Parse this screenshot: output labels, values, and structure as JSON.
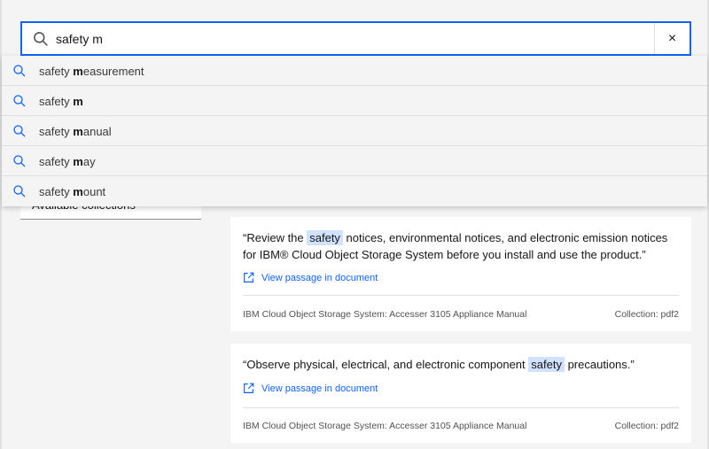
{
  "search": {
    "value": "safety m",
    "clear_label": "×"
  },
  "suggestions": [
    {
      "prefix": "safety ",
      "match": "m",
      "rest": "easurement"
    },
    {
      "prefix": "safety ",
      "match": "m",
      "rest": ""
    },
    {
      "prefix": "safety ",
      "match": "m",
      "rest": "anual"
    },
    {
      "prefix": "safety ",
      "match": "m",
      "rest": "ay"
    },
    {
      "prefix": "safety ",
      "match": "m",
      "rest": "ount"
    }
  ],
  "collections_dropdown": {
    "label": "Available collections",
    "chevron": "⌄"
  },
  "results": [
    {
      "quote_before": "“Review the ",
      "highlight": "safety",
      "quote_after": " notices, environmental notices, and electronic emission notices for IBM® Cloud Object Storage System before you install and use the product.”",
      "view_label": "View passage in document",
      "source": "IBM Cloud Object Storage System: Accesser 3105 Appliance Manual",
      "collection": "Collection: pdf2"
    },
    {
      "quote_before": "“Observe physical, electrical, and electronic component ",
      "highlight": "safety",
      "quote_after": " precautions.”",
      "view_label": "View passage in document",
      "source": "IBM Cloud Object Storage System: Accesser 3105 Appliance Manual",
      "collection": "Collection: pdf2"
    }
  ],
  "colors": {
    "accent": "#0f62fe",
    "highlight": "#d0e2ff",
    "background": "#f4f4f4"
  }
}
